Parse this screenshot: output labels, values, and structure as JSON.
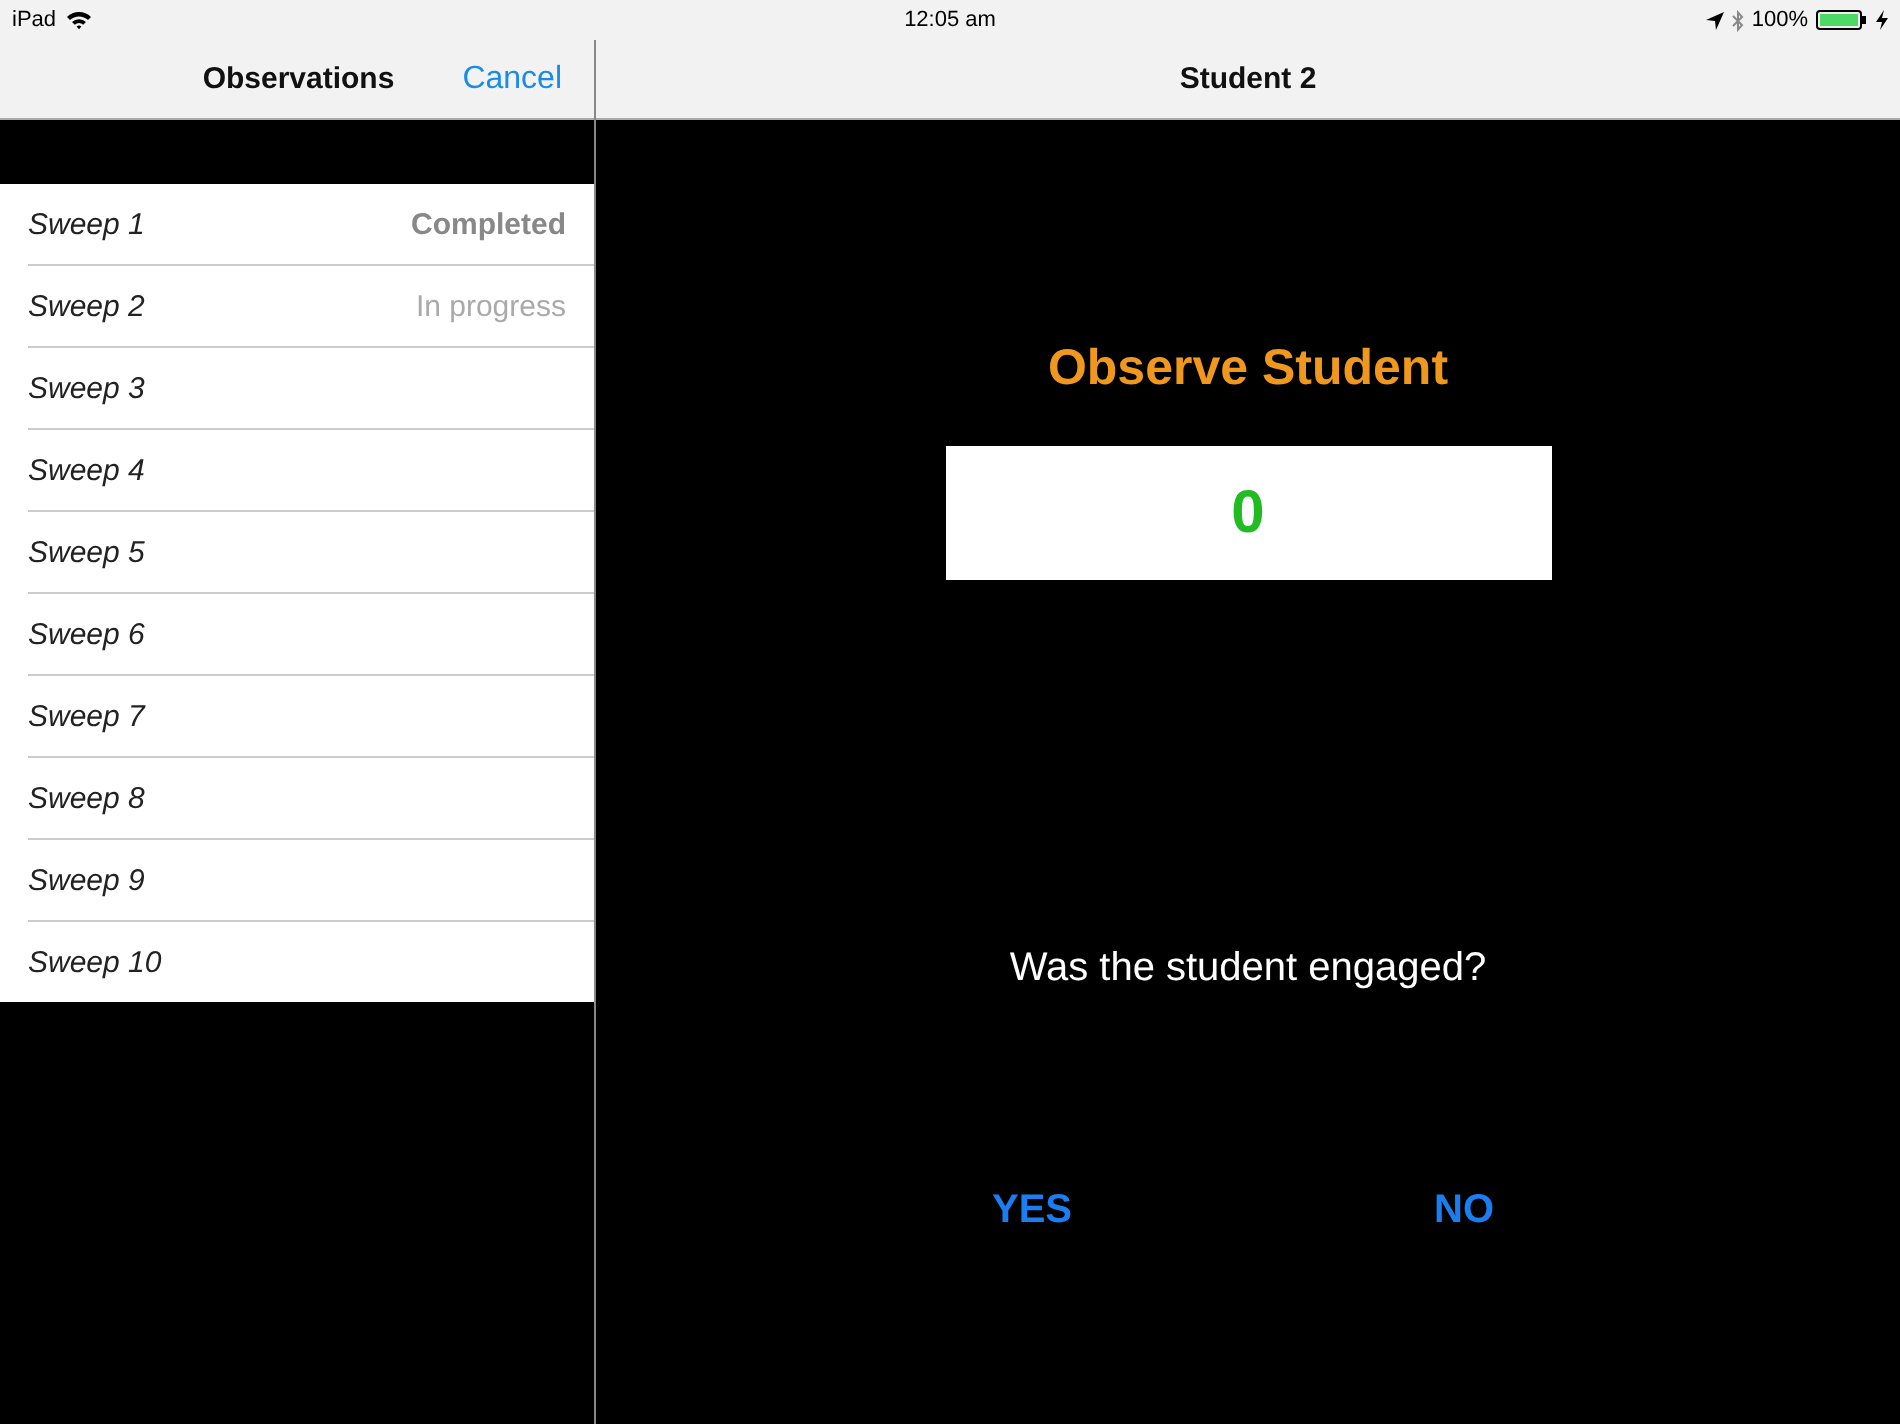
{
  "status_bar": {
    "carrier": "iPad",
    "time": "12:05 am",
    "battery": "100%"
  },
  "master": {
    "title": "Observations",
    "cancel": "Cancel",
    "sweeps": [
      {
        "label": "Sweep 1",
        "status": "Completed",
        "kind": "completed"
      },
      {
        "label": "Sweep 2",
        "status": "In progress",
        "kind": "in_progress"
      },
      {
        "label": "Sweep 3"
      },
      {
        "label": "Sweep 4"
      },
      {
        "label": "Sweep 5"
      },
      {
        "label": "Sweep 6"
      },
      {
        "label": "Sweep 7"
      },
      {
        "label": "Sweep 8"
      },
      {
        "label": "Sweep 9"
      },
      {
        "label": "Sweep 10"
      }
    ]
  },
  "detail": {
    "title": "Student 2",
    "heading": "Observe Student",
    "counter": "0",
    "question": "Was the student engaged?",
    "answers": [
      "YES",
      "NO"
    ]
  }
}
